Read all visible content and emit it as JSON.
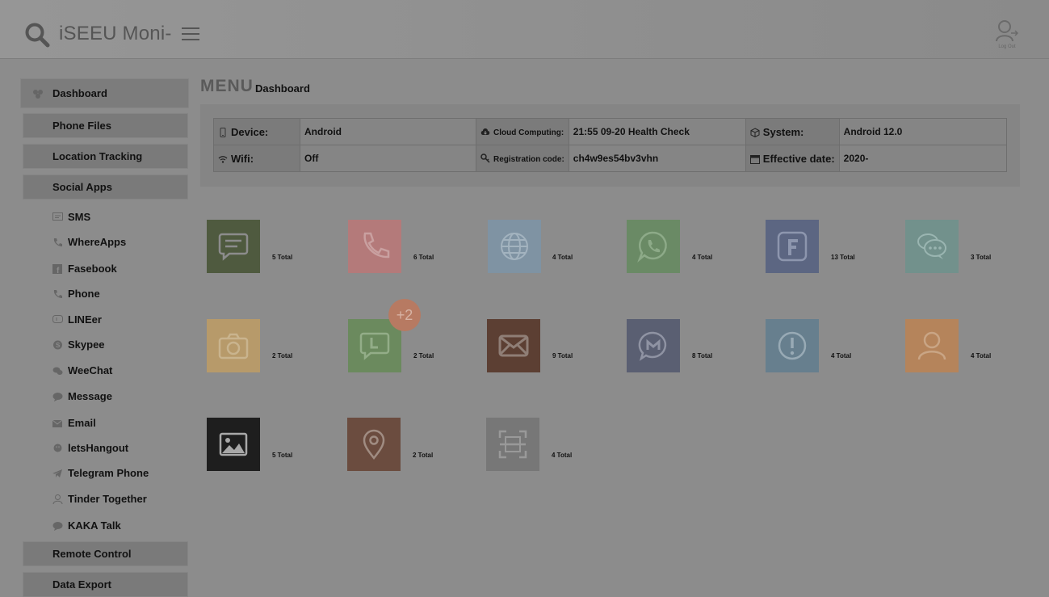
{
  "header": {
    "brand": "iSEEU Moni-",
    "logout_label": "Log Out"
  },
  "sidebar": {
    "top_items": [
      {
        "label": "Dashboard"
      },
      {
        "label": "Phone Files"
      },
      {
        "label": "Location Tracking"
      },
      {
        "label": "Social Apps"
      }
    ],
    "sub_items": [
      {
        "label": "SMS",
        "icon": "chat-icon"
      },
      {
        "label": "WhereApps",
        "icon": "phone-icon"
      },
      {
        "label": "Fasebook",
        "icon": "facebook-icon"
      },
      {
        "label": "Phone",
        "icon": "phone-icon"
      },
      {
        "label": "LINEer",
        "icon": "line-icon"
      },
      {
        "label": "Skypee",
        "icon": "skype-icon"
      },
      {
        "label": "WeeChat",
        "icon": "wechat-icon"
      },
      {
        "label": "Message",
        "icon": "message-icon"
      },
      {
        "label": "Email",
        "icon": "email-icon"
      },
      {
        "label": "letsHangout",
        "icon": "hangout-icon"
      },
      {
        "label": "Telegram Phone",
        "icon": "telegram-icon"
      },
      {
        "label": "Tinder Together",
        "icon": "user-icon"
      },
      {
        "label": "KAKA Talk",
        "icon": "talk-icon"
      }
    ],
    "bottom_items": [
      {
        "label": "Remote Control"
      },
      {
        "label": "Data Export"
      }
    ]
  },
  "main": {
    "menu_title": "MENU",
    "breadcrumb": "Dashboard",
    "info": {
      "device_label": "Device:",
      "device_value": "Android",
      "cloud_label": "Cloud Computing:",
      "cloud_value": "21:55 09-20 Health Check",
      "system_label": "System:",
      "system_value": "Android 12.0",
      "wifi_label": "Wifi:",
      "wifi_value": "Off",
      "reg_label": "Registration code:",
      "reg_value": "ch4w9es54bv3vhn",
      "eff_label": "Effective date:",
      "eff_value": "2020-"
    },
    "tiles": [
      {
        "icon": "sms-icon",
        "count": "5 Total",
        "color": "#4f5a3f"
      },
      {
        "icon": "phone-call-icon",
        "count": "6 Total",
        "color": "#b47a7a"
      },
      {
        "icon": "globe-icon",
        "count": "4 Total",
        "color": "#7f93a3"
      },
      {
        "icon": "whatsapp-icon",
        "count": "4 Total",
        "color": "#6a8a65"
      },
      {
        "icon": "facebook-icon",
        "count": "13 Total",
        "color": "#5c6682"
      },
      {
        "icon": "chat-bubbles-icon",
        "count": "3 Total",
        "color": "#72918c"
      },
      {
        "icon": "camera-icon",
        "count": "2 Total",
        "color": "#b79a6a"
      },
      {
        "icon": "line-icon",
        "count": "2 Total",
        "color": "#6b8a5e",
        "badge": "+2"
      },
      {
        "icon": "mail-icon",
        "count": "9 Total",
        "color": "#5c3f33"
      },
      {
        "icon": "messenger-icon",
        "count": "8 Total",
        "color": "#5a5f72"
      },
      {
        "icon": "alert-icon",
        "count": "4 Total",
        "color": "#677f8e"
      },
      {
        "icon": "person-icon",
        "count": "4 Total",
        "color": "#b5845b"
      },
      {
        "icon": "image-icon",
        "count": "5 Total",
        "color": "#1e1e1e"
      },
      {
        "icon": "location-pin-icon",
        "count": "2 Total",
        "color": "#6b4c3f"
      },
      {
        "icon": "scan-icon",
        "count": "4 Total",
        "color": "#777777"
      }
    ]
  }
}
